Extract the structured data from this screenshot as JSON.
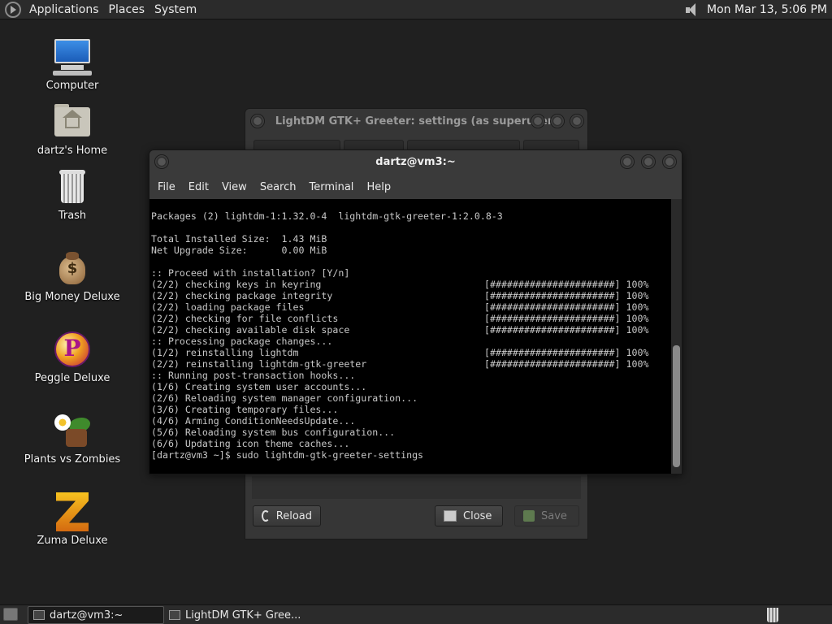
{
  "top_panel": {
    "menu": [
      "Applications",
      "Places",
      "System"
    ],
    "clock": "Mon Mar 13,  5:06 PM"
  },
  "desktop_icons": [
    {
      "label": "Computer",
      "icon": "computer-icon"
    },
    {
      "label": "dartz's Home",
      "icon": "home-folder-icon"
    },
    {
      "label": "Trash",
      "icon": "trash-icon"
    },
    {
      "label": "Big Money Deluxe",
      "icon": "money-bag-icon"
    },
    {
      "label": "Peggle Deluxe",
      "icon": "peggle-icon"
    },
    {
      "label": "Plants vs Zombies",
      "icon": "plants-vs-zombies-icon"
    },
    {
      "label": "Zuma Deluxe",
      "icon": "zuma-icon"
    }
  ],
  "settings_window": {
    "title": "LightDM GTK+ Greeter: settings (as superuser)",
    "buttons": {
      "reload": "Reload",
      "close": "Close",
      "save": "Save"
    }
  },
  "terminal": {
    "title": "dartz@vm3:~",
    "menu": [
      "File",
      "Edit",
      "View",
      "Search",
      "Terminal",
      "Help"
    ],
    "lines": [
      {
        "text": "Packages (2) lightdm-1:1.32.0-4  lightdm-gtk-greeter-1:2.0.8-3",
        "right": ""
      },
      {
        "text": "",
        "right": ""
      },
      {
        "text": "Total Installed Size:  1.43 MiB",
        "right": ""
      },
      {
        "text": "Net Upgrade Size:      0.00 MiB",
        "right": ""
      },
      {
        "text": "",
        "right": ""
      },
      {
        "text": ":: Proceed with installation? [Y/n]",
        "right": ""
      },
      {
        "text": "(2/2) checking keys in keyring",
        "right": "[######################] 100%"
      },
      {
        "text": "(2/2) checking package integrity",
        "right": "[######################] 100%"
      },
      {
        "text": "(2/2) loading package files",
        "right": "[######################] 100%"
      },
      {
        "text": "(2/2) checking for file conflicts",
        "right": "[######################] 100%"
      },
      {
        "text": "(2/2) checking available disk space",
        "right": "[######################] 100%"
      },
      {
        "text": ":: Processing package changes...",
        "right": ""
      },
      {
        "text": "(1/2) reinstalling lightdm",
        "right": "[######################] 100%"
      },
      {
        "text": "(2/2) reinstalling lightdm-gtk-greeter",
        "right": "[######################] 100%"
      },
      {
        "text": ":: Running post-transaction hooks...",
        "right": ""
      },
      {
        "text": "(1/6) Creating system user accounts...",
        "right": ""
      },
      {
        "text": "(2/6) Reloading system manager configuration...",
        "right": ""
      },
      {
        "text": "(3/6) Creating temporary files...",
        "right": ""
      },
      {
        "text": "(4/6) Arming ConditionNeedsUpdate...",
        "right": ""
      },
      {
        "text": "(5/6) Reloading system bus configuration...",
        "right": ""
      },
      {
        "text": "(6/6) Updating icon theme caches...",
        "right": ""
      },
      {
        "text": "[dartz@vm3 ~]$ sudo lightdm-gtk-greeter-settings",
        "right": ""
      }
    ]
  },
  "taskbar": {
    "tasks": [
      {
        "label": "dartz@vm3:~",
        "active": true
      },
      {
        "label": "LightDM GTK+ Gree...",
        "active": false
      }
    ]
  }
}
